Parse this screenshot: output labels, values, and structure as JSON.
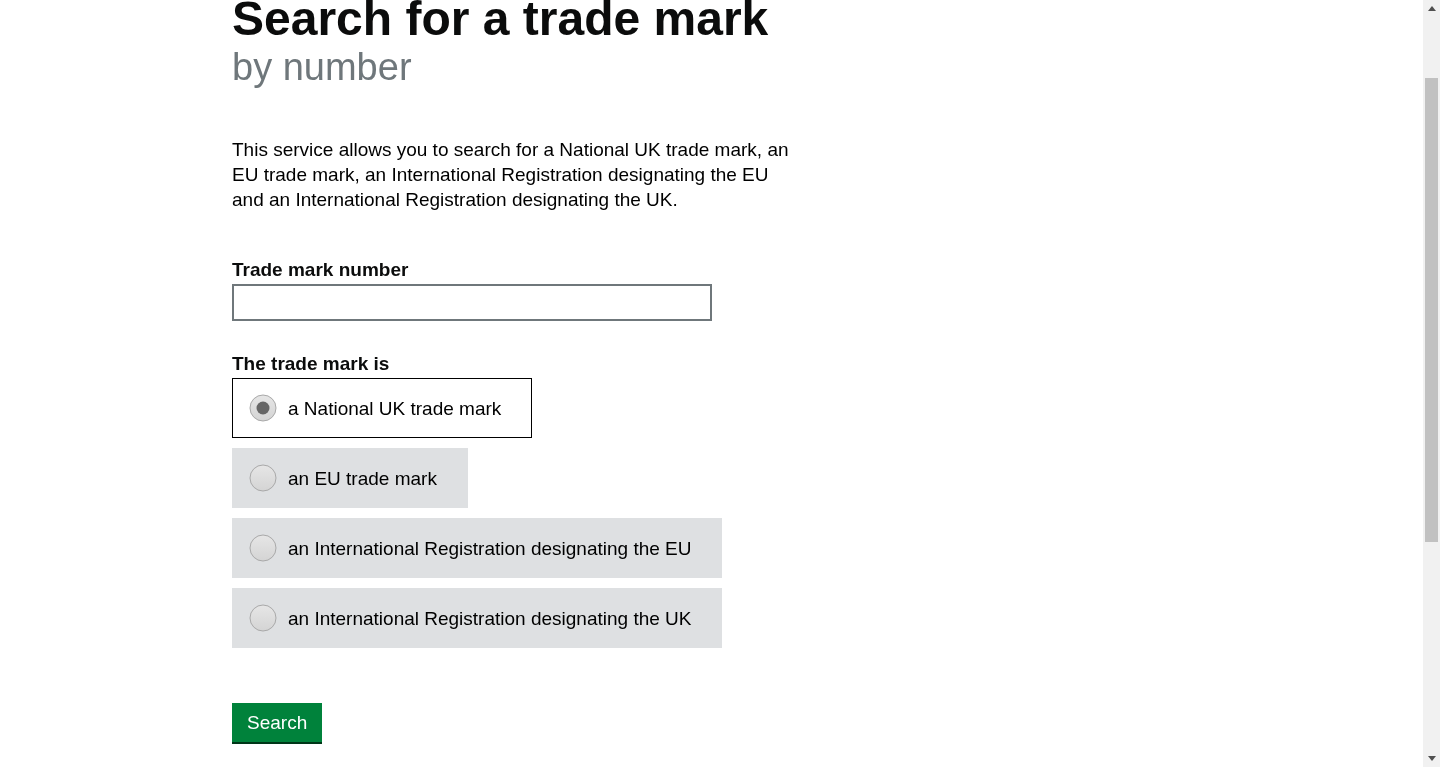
{
  "heading": {
    "title": "Search for a trade mark",
    "subtitle": "by number"
  },
  "intro": "This service allows you to search for a National UK trade mark, an EU trade mark, an International Registration designating the EU and an International Registration designating the UK.",
  "number_field": {
    "label": "Trade mark number"
  },
  "type_group": {
    "label": "The trade mark is",
    "options": [
      {
        "label": "a National UK trade mark",
        "selected": true
      },
      {
        "label": "an EU trade mark",
        "selected": false
      },
      {
        "label": "an International Registration designating the EU",
        "selected": false
      },
      {
        "label": "an International Registration designating the UK",
        "selected": false
      }
    ]
  },
  "submit_button": {
    "label": "Search"
  }
}
